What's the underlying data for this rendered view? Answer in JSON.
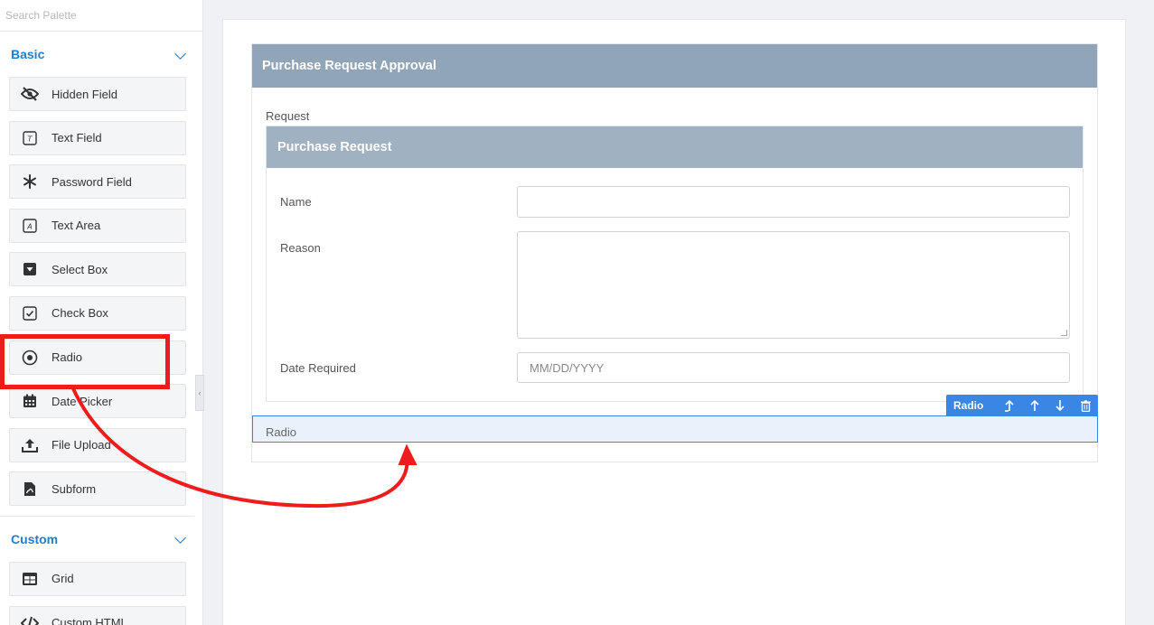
{
  "sidebar": {
    "search_placeholder": "Search Palette",
    "sections": {
      "basic": {
        "title": "Basic",
        "items": [
          {
            "label": "Hidden Field",
            "icon": "eye-slash-icon"
          },
          {
            "label": "Text Field",
            "icon": "text-field-icon"
          },
          {
            "label": "Password Field",
            "icon": "asterisk-icon"
          },
          {
            "label": "Text Area",
            "icon": "text-area-icon"
          },
          {
            "label": "Select Box",
            "icon": "select-box-icon"
          },
          {
            "label": "Check Box",
            "icon": "checkbox-icon"
          },
          {
            "label": "Radio",
            "icon": "radio-icon"
          },
          {
            "label": "Date Picker",
            "icon": "calendar-icon"
          },
          {
            "label": "File Upload",
            "icon": "upload-icon"
          },
          {
            "label": "Subform",
            "icon": "subform-icon"
          }
        ]
      },
      "custom": {
        "title": "Custom",
        "items": [
          {
            "label": "Grid",
            "icon": "grid-icon"
          },
          {
            "label": "Custom HTML",
            "icon": "code-icon"
          }
        ]
      }
    }
  },
  "form": {
    "title": "Purchase Request Approval",
    "request_label": "Request",
    "subpanel_title": "Purchase Request",
    "fields": {
      "name_label": "Name",
      "reason_label": "Reason",
      "date_label": "Date Required",
      "date_placeholder": "MM/DD/YYYY"
    },
    "dropped_field_label": "Radio",
    "toolbar_label": "Radio"
  },
  "colors": {
    "accent": "#1e7ed6",
    "panel_header": "#91a5b8",
    "subpanel_header": "#a0b1c2",
    "selection": "#3a86e4",
    "annotation": "#ee1c1c"
  }
}
